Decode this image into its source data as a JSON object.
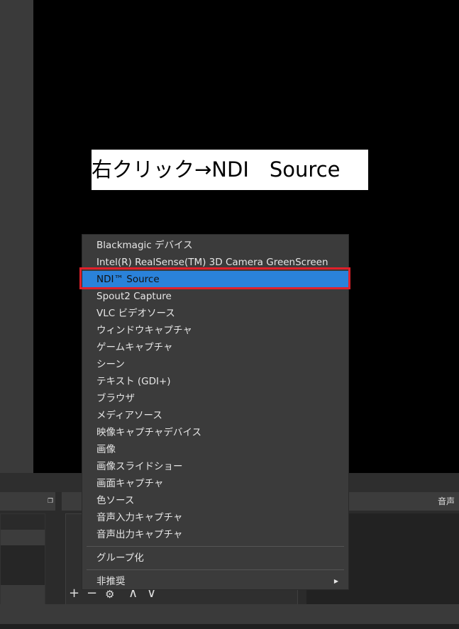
{
  "preview": {
    "caption": "右クリック→NDI　Source"
  },
  "docks": {
    "audio_title": "音声ミ"
  },
  "menu": {
    "items": [
      "Blackmagic デバイス",
      "Intel(R) RealSense(TM) 3D Camera GreenScreen",
      "NDI™ Source",
      "Spout2 Capture",
      "VLC ビデオソース",
      "ウィンドウキャプチャ",
      "ゲームキャプチャ",
      "シーン",
      "テキスト (GDI+)",
      "ブラウザ",
      "メディアソース",
      "映像キャプチャデバイス",
      "画像",
      "画像スライドショー",
      "画面キャプチャ",
      "色ソース",
      "音声入力キャプチャ",
      "音声出力キャプチャ"
    ],
    "group": "グループ化",
    "deprecated": "非推奨",
    "selected_index": 2
  },
  "toolbar": {
    "add": "+",
    "remove": "−",
    "settings": "⚙",
    "up": "∧",
    "down": "∨"
  },
  "colors": {
    "highlight": "#2a82da",
    "annotation": "#e0202a"
  }
}
